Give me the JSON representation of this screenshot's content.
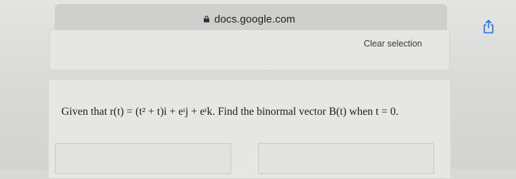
{
  "browser": {
    "url": "docs.google.com",
    "lock_icon": "lock-icon",
    "share_icon": "share-icon"
  },
  "toolbar": {
    "clear_selection_label": "Clear selection"
  },
  "question": {
    "text": "Given that r(t) = (t² + t)i + eᵗj + eᵗk. Find the binormal vector B(t) when t = 0."
  },
  "colors": {
    "background": "#d8d8d6",
    "card": "#e6e6e3",
    "text": "#1d1d1d"
  }
}
